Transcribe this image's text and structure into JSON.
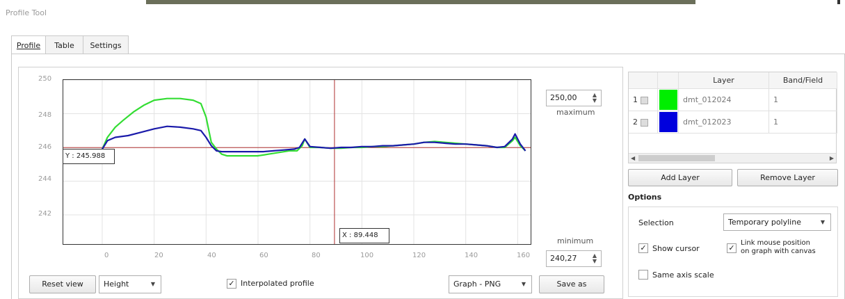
{
  "window": {
    "title": "Profile Tool"
  },
  "tabs": [
    {
      "label": "Profile",
      "active": true
    },
    {
      "label": "Table",
      "active": false
    },
    {
      "label": "Settings",
      "active": false
    }
  ],
  "plot": {
    "y_ticks": [
      "250",
      "248",
      "246",
      "244",
      "242"
    ],
    "x_ticks": [
      "0",
      "20",
      "40",
      "60",
      "80",
      "100",
      "120",
      "140",
      "160"
    ],
    "cursor": {
      "x_label": "X : 89.448",
      "y_label": "Y : 245.988",
      "x": 89.448,
      "y": 245.988
    },
    "colors": {
      "cursor": "#b03030",
      "layer1": "#33dd33",
      "layer2": "#1a1aaa"
    }
  },
  "chart_data": {
    "type": "line",
    "xlim": [
      -15,
      165
    ],
    "ylim": [
      240.27,
      250.0
    ],
    "grid": true,
    "series": [
      {
        "name": "dmt_012024",
        "color": "#33dd33",
        "points": [
          [
            0,
            245.9
          ],
          [
            2,
            246.6
          ],
          [
            5,
            247.2
          ],
          [
            8,
            247.6
          ],
          [
            12,
            248.1
          ],
          [
            16,
            248.5
          ],
          [
            20,
            248.8
          ],
          [
            25,
            248.9
          ],
          [
            30,
            248.9
          ],
          [
            35,
            248.8
          ],
          [
            38,
            248.6
          ],
          [
            40,
            247.8
          ],
          [
            42,
            246.3
          ],
          [
            44,
            245.9
          ],
          [
            46,
            245.6
          ],
          [
            48,
            245.5
          ],
          [
            52,
            245.5
          ],
          [
            56,
            245.5
          ],
          [
            60,
            245.5
          ],
          [
            64,
            245.6
          ],
          [
            68,
            245.7
          ],
          [
            72,
            245.8
          ],
          [
            75,
            245.8
          ],
          [
            77,
            246.1
          ],
          [
            78,
            246.5
          ],
          [
            80,
            246.0
          ],
          [
            84,
            246.0
          ],
          [
            88,
            245.95
          ],
          [
            92,
            245.95
          ],
          [
            96,
            246.0
          ],
          [
            100,
            246.0
          ],
          [
            104,
            246.05
          ],
          [
            108,
            246.05
          ],
          [
            112,
            246.1
          ],
          [
            116,
            246.15
          ],
          [
            120,
            246.2
          ],
          [
            124,
            246.3
          ],
          [
            128,
            246.35
          ],
          [
            132,
            246.3
          ],
          [
            136,
            246.25
          ],
          [
            140,
            246.2
          ],
          [
            144,
            246.15
          ],
          [
            148,
            246.1
          ],
          [
            152,
            246.0
          ],
          [
            155,
            246.0
          ],
          [
            158,
            246.4
          ],
          [
            159,
            246.6
          ],
          [
            161,
            246.1
          ],
          [
            163,
            245.8
          ]
        ]
      },
      {
        "name": "dmt_012023",
        "color": "#1a1aaa",
        "points": [
          [
            0,
            245.9
          ],
          [
            2,
            246.4
          ],
          [
            5,
            246.6
          ],
          [
            10,
            246.7
          ],
          [
            15,
            246.9
          ],
          [
            20,
            247.1
          ],
          [
            25,
            247.25
          ],
          [
            30,
            247.2
          ],
          [
            35,
            247.1
          ],
          [
            38,
            247.0
          ],
          [
            40,
            246.6
          ],
          [
            42,
            246.1
          ],
          [
            44,
            245.8
          ],
          [
            46,
            245.75
          ],
          [
            50,
            245.75
          ],
          [
            54,
            245.75
          ],
          [
            58,
            245.75
          ],
          [
            62,
            245.75
          ],
          [
            66,
            245.8
          ],
          [
            70,
            245.85
          ],
          [
            74,
            245.9
          ],
          [
            76,
            246.0
          ],
          [
            78,
            246.5
          ],
          [
            80,
            246.05
          ],
          [
            84,
            246.0
          ],
          [
            88,
            245.95
          ],
          [
            92,
            246.0
          ],
          [
            96,
            246.0
          ],
          [
            100,
            246.05
          ],
          [
            104,
            246.05
          ],
          [
            108,
            246.1
          ],
          [
            112,
            246.1
          ],
          [
            116,
            246.15
          ],
          [
            120,
            246.2
          ],
          [
            124,
            246.3
          ],
          [
            128,
            246.3
          ],
          [
            132,
            246.25
          ],
          [
            136,
            246.2
          ],
          [
            140,
            246.2
          ],
          [
            144,
            246.15
          ],
          [
            148,
            246.1
          ],
          [
            152,
            246.0
          ],
          [
            155,
            246.05
          ],
          [
            158,
            246.5
          ],
          [
            159,
            246.8
          ],
          [
            161,
            246.2
          ],
          [
            163,
            245.8
          ]
        ]
      }
    ]
  },
  "scale": {
    "maximum_value": "250,00",
    "maximum_label": "maximum",
    "minimum_value": "240,27",
    "minimum_label": "minimum"
  },
  "bottom_bar": {
    "reset_view": "Reset view",
    "height_combo": "Height",
    "interpolated_label": "Interpolated profile",
    "interpolated_checked": true,
    "export_combo": "Graph - PNG",
    "save_as": "Save as"
  },
  "layers_table": {
    "headers": [
      "Layer",
      "Band/Field"
    ],
    "rows": [
      {
        "index": "1",
        "color": "#00ee00",
        "layer": "dmt_012024",
        "band": "1"
      },
      {
        "index": "2",
        "color": "#0000dd",
        "layer": "dmt_012023",
        "band": "1"
      }
    ]
  },
  "layer_buttons": {
    "add": "Add Layer",
    "remove": "Remove Layer"
  },
  "options": {
    "title": "Options",
    "selection_label": "Selection",
    "selection_value": "Temporary polyline",
    "show_cursor_label": "Show cursor",
    "show_cursor_checked": true,
    "link_mouse_line1": "Link mouse position",
    "link_mouse_line2": "on graph with canvas",
    "link_mouse_checked": true,
    "same_axis_label": "Same axis scale",
    "same_axis_checked": false
  }
}
